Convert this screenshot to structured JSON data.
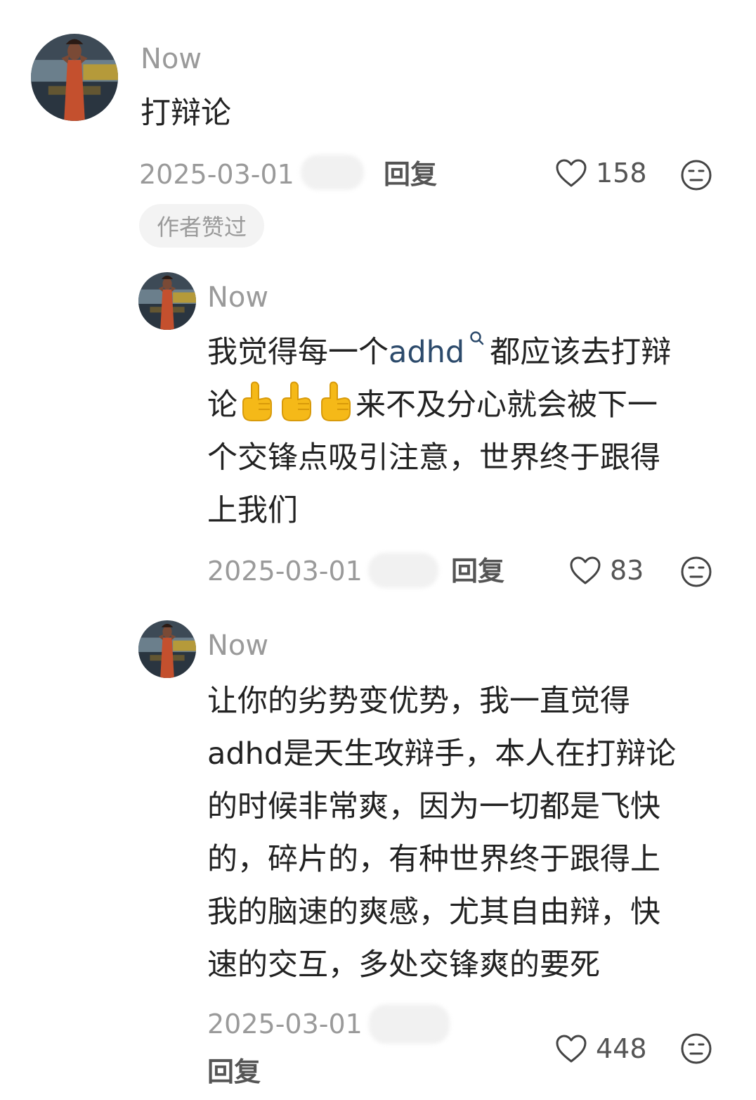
{
  "comments": [
    {
      "username": "Now",
      "text": "打辩论",
      "date": "2025-03-01",
      "reply_label": "回复",
      "likes": "158",
      "badge": "作者赞过"
    },
    {
      "username": "Now",
      "text_part1": "我觉得每一个",
      "link": "adhd",
      "text_part2": "都应该去打辩",
      "line2": "论",
      "line2_after_emoji": "来不及分心就会被下一",
      "line3": "个交锋点吸引注意，世界终于跟得",
      "line4": "上我们",
      "date": "2025-03-01",
      "reply_label": "回复",
      "likes": "83"
    },
    {
      "username": "Now",
      "lines": [
        "让你的劣势变优势，我一直觉得",
        "adhd是天生攻辩手，本人在打辩论",
        "的时候非常爽，因为一切都是飞快",
        "的，碎片的，有种世界终于跟得上",
        "我的脑速的爽感，尤其自由辩，快",
        "速的交互，多处交锋爽的要死"
      ],
      "date": "2025-03-01",
      "reply_label": "回复",
      "likes": "448"
    }
  ],
  "icons": {
    "like": "heart-outline-icon",
    "dislike": "neutral-face-icon",
    "search": "search-icon",
    "emoji": "index-pointing-up-emoji"
  },
  "colors": {
    "link": "#2c4a6b",
    "muted": "#9a9a9a",
    "emoji": "#f5b918"
  }
}
